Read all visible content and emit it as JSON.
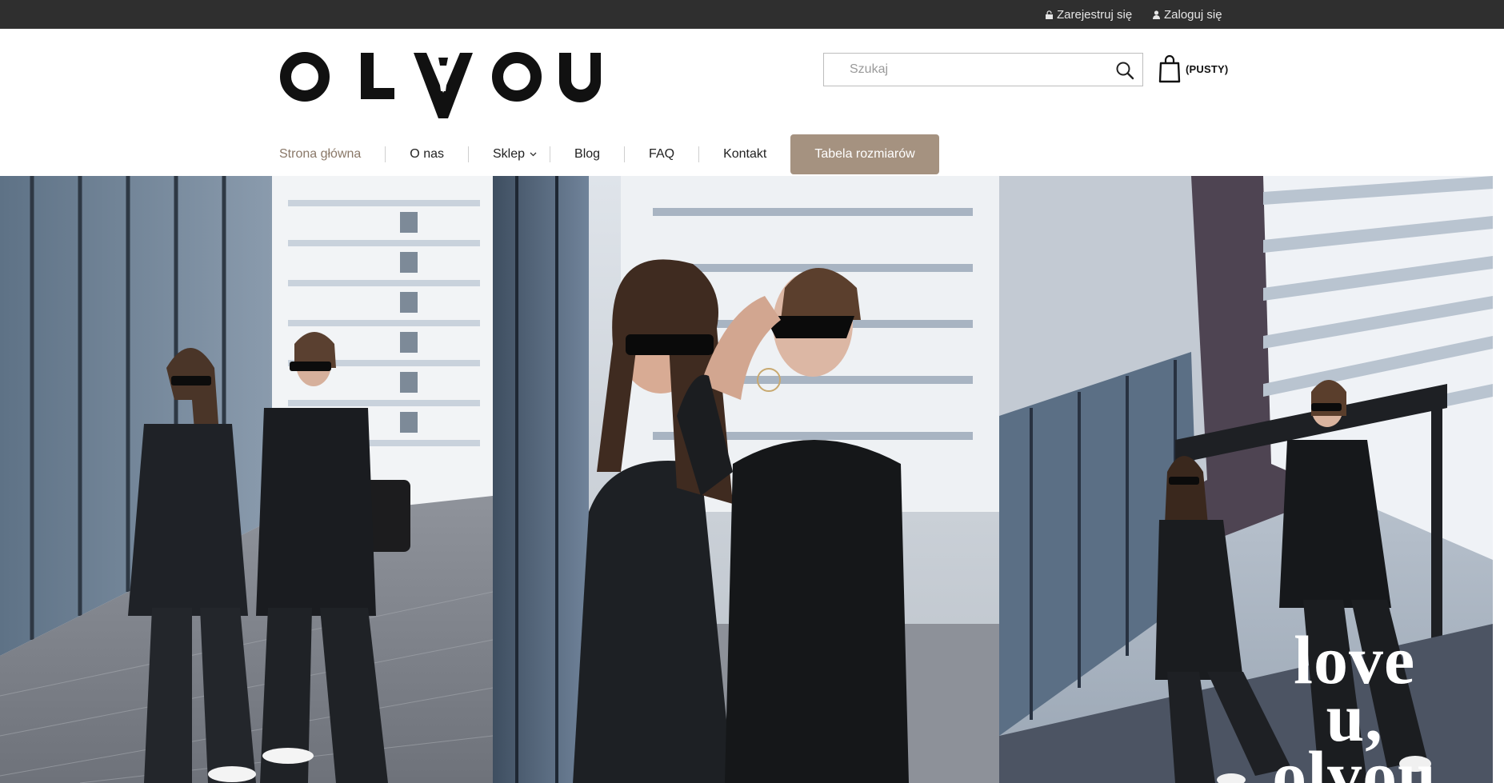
{
  "topbar": {
    "register_label": "Zarejestruj się",
    "login_label": "Zaloguj się",
    "lock_icon": "lock-icon",
    "user_icon": "user-icon"
  },
  "header": {
    "logo_text": "OLVOU",
    "search": {
      "placeholder": "Szukaj",
      "value": ""
    },
    "cart": {
      "label": "(PUSTY)",
      "icon": "shopping-bag-icon"
    }
  },
  "nav": {
    "items": [
      {
        "label": "Strona główna",
        "active": true
      },
      {
        "label": "O nas"
      },
      {
        "label": "Sklep",
        "has_dropdown": true
      },
      {
        "label": "Blog"
      },
      {
        "label": "FAQ"
      },
      {
        "label": "Kontakt"
      },
      {
        "label": "Tabela rozmiarów",
        "highlight": true
      }
    ]
  },
  "hero": {
    "slogan_lines": [
      "love",
      "u,",
      "olvou"
    ]
  },
  "colors": {
    "topbar": "#2f2f2f",
    "accent": "#a59280",
    "active_nav": "#8a7868"
  }
}
